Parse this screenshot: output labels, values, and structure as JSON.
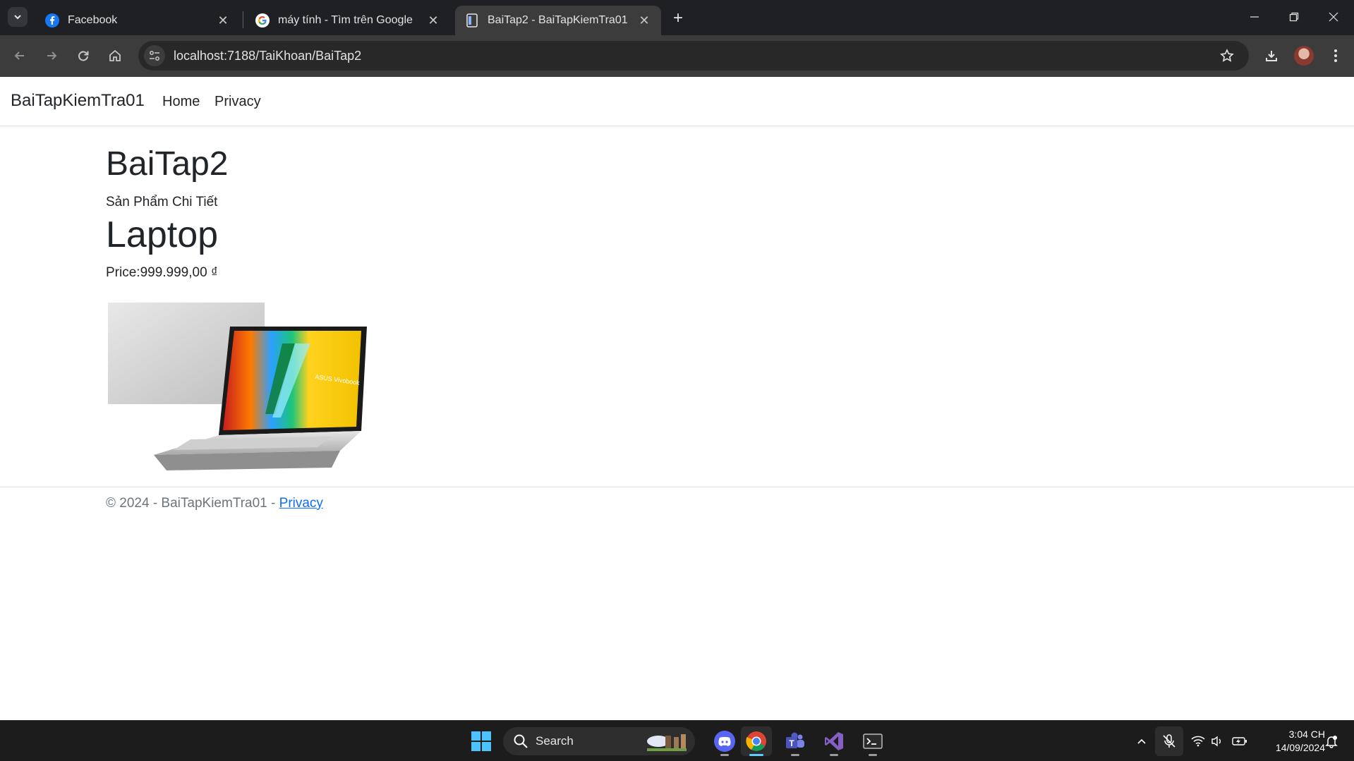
{
  "browser": {
    "tabs": [
      {
        "title": "Facebook",
        "icon": "facebook-icon"
      },
      {
        "title": "máy tính - Tìm trên Google",
        "icon": "google-icon"
      },
      {
        "title": "BaiTap2 - BaiTapKiemTra01",
        "icon": "page-icon",
        "active": true
      }
    ],
    "url": "localhost:7188/TaiKhoan/BaiTap2"
  },
  "site": {
    "brand": "BaiTapKiemTra01",
    "nav": [
      "Home",
      "Privacy"
    ]
  },
  "main": {
    "page_title": "BaiTap2",
    "subtitle": "Sản Phẩm Chi Tiết",
    "product_name": "Laptop",
    "price_text": "Price:999.999,00 ₫",
    "image_label": "ASUS Vivobook"
  },
  "footer": {
    "text": "© 2024 - BaiTapKiemTra01 - ",
    "link": "Privacy"
  },
  "taskbar": {
    "search_label": "Search",
    "time": "3:04 CH",
    "date": "14/09/2024"
  },
  "colors": {
    "chrome_bg": "#1f2023",
    "toolbar_bg": "#3c3c3c",
    "link": "#0d6efd",
    "taskbar_bg": "#1c1c1c"
  }
}
